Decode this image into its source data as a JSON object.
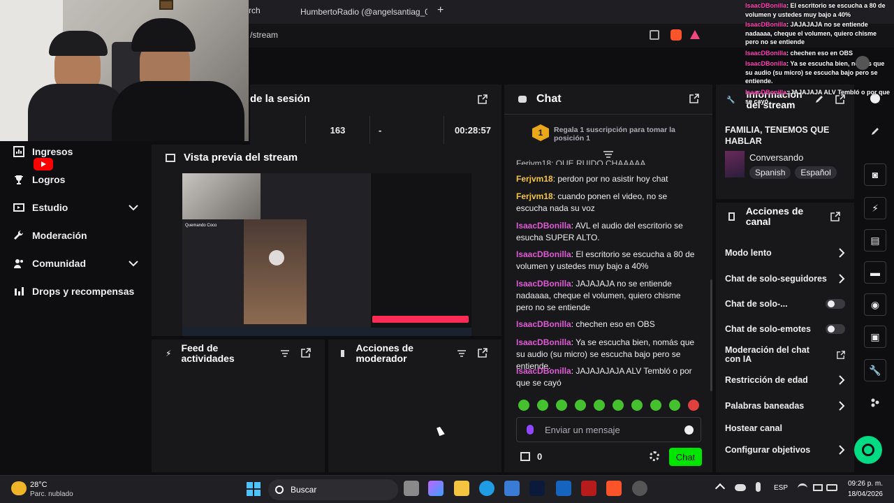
{
  "browser": {
    "tab_search_partial": "rch",
    "tab_active": "HumbertoRadio (@angelsantiag_0) |",
    "url_partial": "/stream"
  },
  "session": {
    "title": "de la sesión",
    "stats": [
      "163",
      "-",
      "00:28:57"
    ]
  },
  "preview": {
    "title": "Vista previa del stream",
    "inner_overlay_label": "Quemando Coco"
  },
  "nav": {
    "items": [
      {
        "label": "Ingresos",
        "icon": "bar-chart-icon"
      },
      {
        "label": "Logros",
        "icon": "trophy-icon"
      },
      {
        "label": "Estudio",
        "icon": "studio-icon",
        "expandable": true
      },
      {
        "label": "Moderación",
        "icon": "wrench-icon"
      },
      {
        "label": "Comunidad",
        "icon": "people-icon",
        "expandable": true
      },
      {
        "label": "Drops y recompensas",
        "icon": "drops-icon"
      }
    ]
  },
  "feed": {
    "title": "Feed de actividades"
  },
  "mod_actions": {
    "title": "Acciones de moderador"
  },
  "chat": {
    "title": "Chat",
    "gift_text": "Regala 1 suscripción para tomar la posición 1",
    "gift_rank": "1",
    "cut_top": "Ferjvm18: QUE RUIDO CHAAAAA",
    "messages": [
      {
        "user": "Ferjvm18",
        "text": "perdon por no asistir hoy chat",
        "kind": "f"
      },
      {
        "user": "Ferjvm18",
        "text": "cuando ponen el video, no se escucha nada su voz",
        "kind": "f"
      },
      {
        "user": "IsaacDBonilla",
        "text": "AVL el audio del escritorio se esucha SUPER ALTO.",
        "kind": "i"
      },
      {
        "user": "IsaacDBonilla",
        "text": "El escritorio se escucha a 80 de volumen y ustedes muy bajo a 40%",
        "kind": "i"
      },
      {
        "user": "IsaacDBonilla",
        "text": "JAJAJAJA no se entiende nadaaaa, cheque el volumen, quiero chisme pero no se entiende",
        "kind": "i"
      },
      {
        "user": "IsaacDBonilla",
        "text": "chechen eso en OBS",
        "kind": "i"
      },
      {
        "user": "IsaacDBonilla",
        "text": "Ya se escucha bien, nomás que su audio (su micro) se escucha bajo pero se entiende.",
        "kind": "i"
      },
      {
        "user": "IsaacDBonilla",
        "text": "JAJAJAJAJA ALV Tembló o por que se cayó",
        "kind": "i"
      }
    ],
    "input_placeholder": "Enviar un mensaje",
    "points": "0",
    "send_label": "Chat"
  },
  "stream_info": {
    "title": "Información del stream",
    "stream_title": "FAMILIA, TENEMOS QUE HABLAR",
    "category": "Conversando",
    "tags": [
      "Spanish",
      "Español"
    ]
  },
  "channel_actions": {
    "title": "Acciones de canal",
    "rows": [
      {
        "label": "Modo lento",
        "control": "chevron"
      },
      {
        "label": "Chat de solo-seguidores",
        "control": "chevron"
      },
      {
        "label": "Chat de solo-...",
        "control": "toggle"
      },
      {
        "label": "Chat de solo-emotes",
        "control": "toggle"
      },
      {
        "label": "Moderación del chat con IA",
        "control": "external"
      },
      {
        "label": "Restricción de edad",
        "control": "chevron"
      },
      {
        "label": "Palabras baneadas",
        "control": "chevron"
      },
      {
        "label": "Hostear canal",
        "control": "none"
      },
      {
        "label": "Configurar objetivos",
        "control": "chevron"
      }
    ]
  },
  "overlay_chat": [
    {
      "user": "IsaacDBonilla",
      "text": "El escritorio se escucha a 80 de volumen y ustedes muy bajo a 40%"
    },
    {
      "user": "IsaacDBonilla",
      "text": "JAJAJAJA no se entiende nadaaaa, cheque el volumen, quiero chisme pero no se entiende"
    },
    {
      "user": "IsaacDBonilla",
      "text": "chechen eso en OBS"
    },
    {
      "user": "IsaacDBonilla",
      "text": "Ya se escucha bien, nomás que su audio (su micro) se escucha bajo pero se entiende."
    },
    {
      "user": "IsaacDBonilla",
      "text": "JAJAJAJA ALV Tembló o por que se cayó"
    }
  ],
  "taskbar": {
    "temperature": "28°C",
    "weather": "Parc. nublado",
    "search": "Buscar",
    "language": "ESP",
    "time": "09:26 p. m.",
    "date": "18/04/2026"
  },
  "colors": {
    "accent_green": "#00db84",
    "send_green": "#00e500",
    "user_ferjvm": "#f4c542",
    "user_isaac": "#e05ad6",
    "panel_bg": "#18181b",
    "page_bg": "#0e0e10"
  }
}
